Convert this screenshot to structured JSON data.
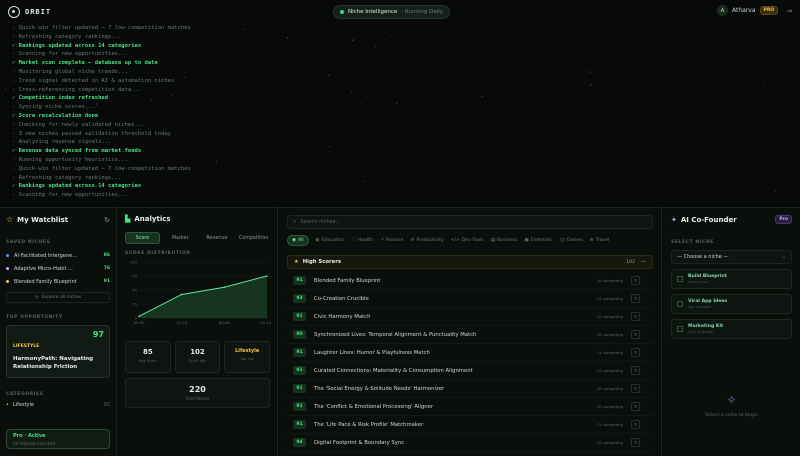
{
  "topbar": {
    "brand": "ORBIT",
    "status_pill": {
      "label": "Niche Intelligence",
      "sub": "· Running Daily"
    },
    "user": {
      "initial": "A",
      "name": "Atharva",
      "plan": "PRO"
    }
  },
  "log": [
    {
      "text": "Quick-win filter updated — 7 low-competition matches",
      "ok": false
    },
    {
      "text": "Refreshing category rankings...",
      "ok": false
    },
    {
      "text": "Rankings updated across 14 categories",
      "ok": true
    },
    {
      "text": "Scanning for new opportunities...",
      "ok": false
    },
    {
      "text": "Market scan complete — database up to date",
      "ok": true
    },
    {
      "text": "Monitoring global niche trends...",
      "ok": false
    },
    {
      "text": "Trend signal detected in AI & automation niches",
      "ok": false
    },
    {
      "text": "Cross-referencing competition data...",
      "ok": false
    },
    {
      "text": "Competition index refreshed",
      "ok": true
    },
    {
      "text": "Syncing niche scores...",
      "ok": false
    },
    {
      "text": "Score recalculation done",
      "ok": true
    },
    {
      "text": "Checking for newly validated niches...",
      "ok": false
    },
    {
      "text": "3 new niches passed validation threshold today",
      "ok": false
    },
    {
      "text": "Analyzing revenue signals...",
      "ok": false
    },
    {
      "text": "Revenue data synced from market feeds",
      "ok": true
    },
    {
      "text": "Running opportunity heuristics...",
      "ok": false
    },
    {
      "text": "Quick-win filter updated — 7 low-competition matches",
      "ok": false
    },
    {
      "text": "Refreshing category rankings...",
      "ok": false
    },
    {
      "text": "Rankings updated across 14 categories",
      "ok": true
    },
    {
      "text": "Scanning for new opportunities...",
      "ok": false
    }
  ],
  "watchlist": {
    "title": "My Watchlist",
    "saved_label": "SAVED NICHES",
    "items": [
      {
        "name": "AI-Facilitated Intergene...",
        "score": "86",
        "color": "#5b8cff"
      },
      {
        "name": "Adaptive Micro-Habit ...",
        "score": "76",
        "color": "#c9a6ff"
      },
      {
        "name": "Blended Family Blueprint",
        "score": "91",
        "color": "#f1c44a"
      }
    ],
    "explore_label": "Explore all niches",
    "top_label": "TOP OPPORTUNITY",
    "top": {
      "category": "LIFESTYLE",
      "score": "97",
      "title": "HarmonyPath: Navigating Relationship Friction"
    },
    "categories_label": "CATEGORIES",
    "categories": [
      {
        "name": "Lifestyle",
        "count": "92"
      }
    ],
    "pro": {
      "title": "Pro · Active",
      "sub": "All features unlocked"
    }
  },
  "analytics": {
    "title": "Analytics",
    "tabs": [
      "Score",
      "Market",
      "Revenue",
      "Competition"
    ],
    "active_tab": 0,
    "dist_label": "SCORE DISTRIBUTION",
    "chart_data": {
      "type": "area",
      "categories": [
        "60-69",
        "70-79",
        "80-89",
        "90-100"
      ],
      "values": [
        3,
        42,
        55,
        75
      ],
      "ylim": [
        0,
        100
      ],
      "yticks": [
        "100",
        "75",
        "50",
        "25",
        "0"
      ]
    },
    "stats": [
      {
        "value": "85",
        "label": "Avg Score",
        "style": "num"
      },
      {
        "value": "102",
        "label": "Quick Win",
        "style": "num"
      },
      {
        "value": "Lifestyle",
        "label": "Top Cat",
        "style": "text"
      }
    ],
    "total": {
      "value": "220",
      "label": "Total Niches"
    }
  },
  "niches": {
    "search_placeholder": "Search niches...",
    "chips": [
      "All",
      "Education",
      "Health",
      "Finance",
      "Productivity",
      "Dev Tools",
      "Business",
      "Entertain.",
      "Games",
      "Travel"
    ],
    "group": {
      "title": "High Scorers",
      "count": "102"
    },
    "rows": [
      {
        "score": "91",
        "name": "Blended Family Blueprint",
        "comp": "16 competing"
      },
      {
        "score": "93",
        "name": "Co-Creation Crucible",
        "comp": "14 competing"
      },
      {
        "score": "91",
        "name": "Civic Harmony Match",
        "comp": "12 competing"
      },
      {
        "score": "90",
        "name": "Synchronized Lives: Temporal Alignment & Punctuality Match",
        "comp": "18 competing"
      },
      {
        "score": "91",
        "name": "Laughter Lines: Humor & Playfulness Match",
        "comp": "14 competing"
      },
      {
        "score": "91",
        "name": "Curated Connections: Materiality & Consumption Alignment",
        "comp": "13 competing"
      },
      {
        "score": "91",
        "name": "The 'Social Energy & Solitude Needs' Harmonizer",
        "comp": "16 competing"
      },
      {
        "score": "91",
        "name": "The 'Conflict & Emotional Processing' Aligner",
        "comp": "20 competing"
      },
      {
        "score": "91",
        "name": "The 'Life Pace & Risk Profile' Matchmaker",
        "comp": "21 competing"
      },
      {
        "score": "94",
        "name": "Digital Footprint & Boundary Sync",
        "comp": "18 competing"
      }
    ]
  },
  "copilot": {
    "title": "AI Co-Founder",
    "tag": "Pro",
    "select_label": "SELECT NICHE",
    "select_value": "— Choose a niche —",
    "tools": [
      {
        "title": "Build Blueprint",
        "sub": "Launch plan"
      },
      {
        "title": "Viral App Ideas",
        "sub": "App concepts"
      },
      {
        "title": "Marketing Kit",
        "sub": "Copy & growth"
      }
    ],
    "empty_label": "Select a niche to begin"
  }
}
